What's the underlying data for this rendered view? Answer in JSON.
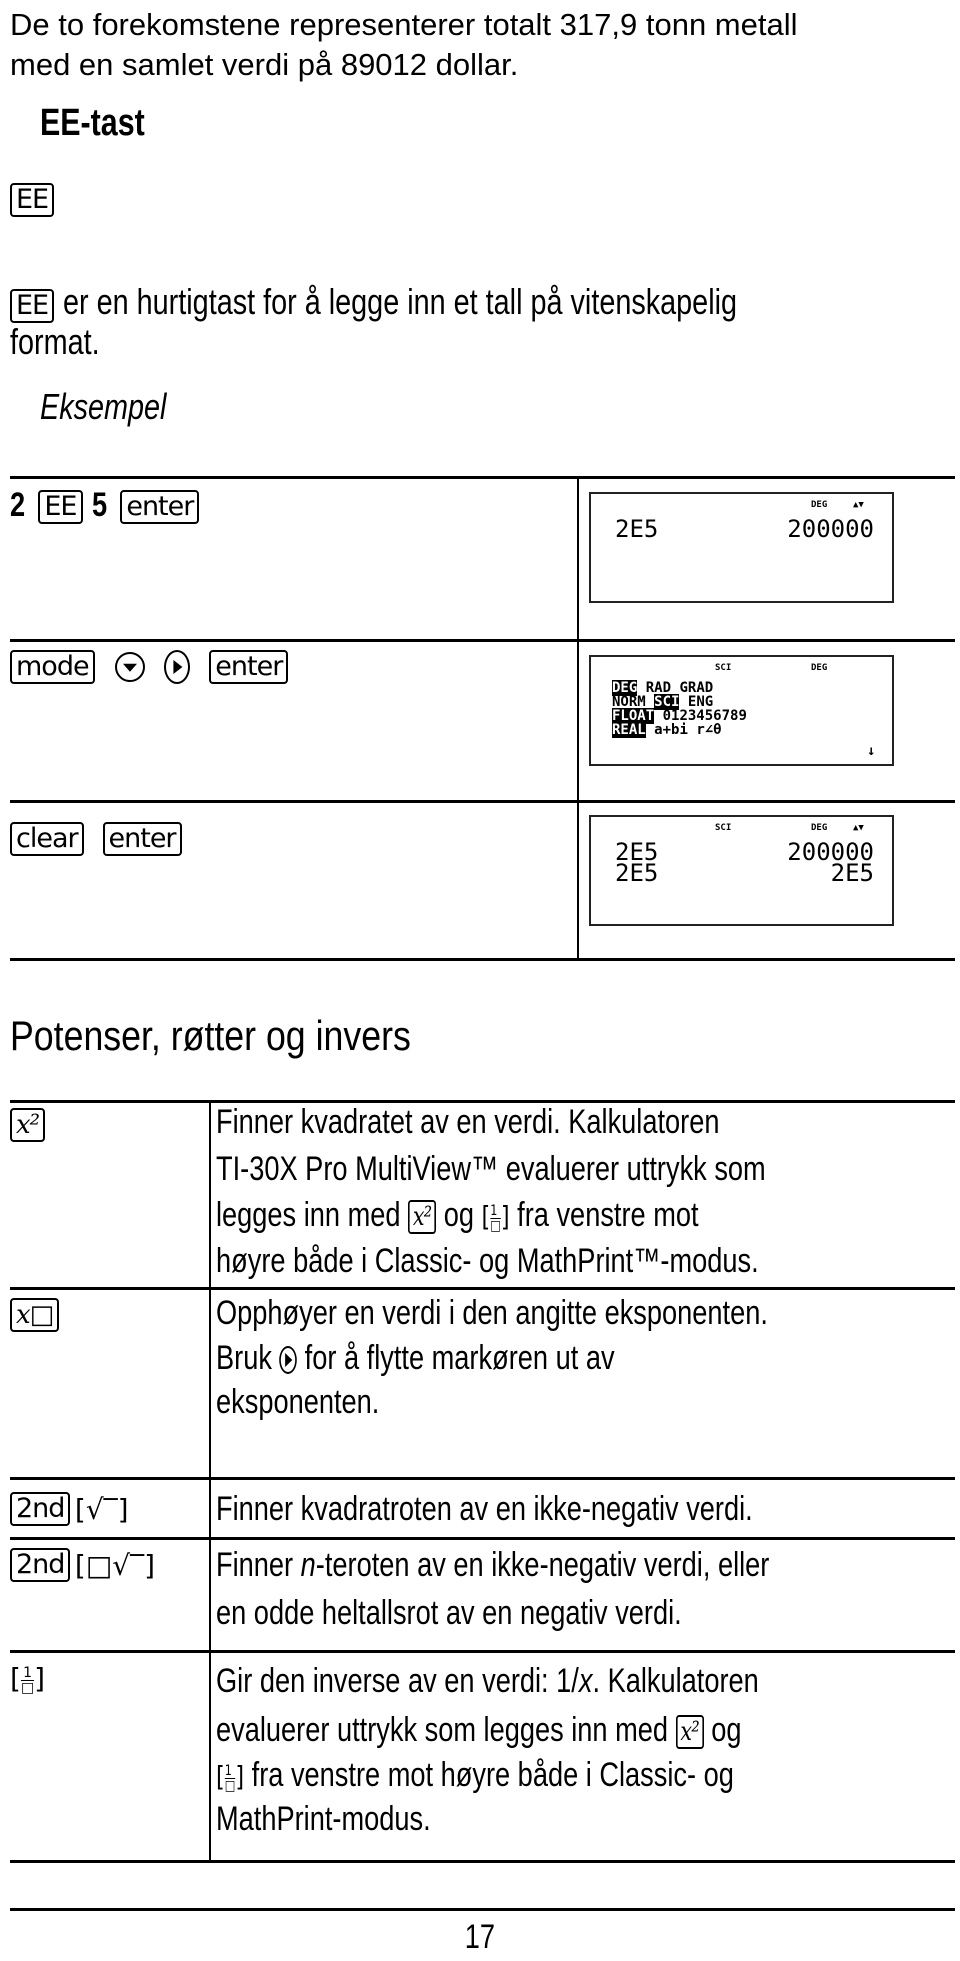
{
  "intro": {
    "lines": [
      "De to forekomstene representerer totalt 317,9 tonn metall",
      "med en samlet verdi på 89012 dollar."
    ]
  },
  "ee": {
    "title": "EE-tast",
    "key": "EE",
    "desc_text": "er en hurtigtast for å legge inn et tall på vitenskapelig",
    "desc_line2": "format.",
    "example_label": "Eksempel"
  },
  "example": {
    "rows": [
      {
        "keys": [
          "2",
          "EE",
          "5",
          "enter"
        ],
        "screen": {
          "indicators": [
            "DEG",
            "▲▼"
          ],
          "lines": [
            {
              "entry": "2E5",
              "result": "200000"
            }
          ]
        }
      },
      {
        "keys": [
          "mode",
          "down-arrow",
          "right-arrow",
          "enter"
        ],
        "screen": {
          "indicators": [
            "SCI",
            "DEG"
          ],
          "menu": [
            [
              "DEG",
              "RAD",
              "GRAD"
            ],
            [
              "NORM",
              "SCI",
              "ENG"
            ],
            [
              "FLOAT",
              "0123456789"
            ],
            [
              "REAL",
              "a+bi",
              "r∠θ"
            ]
          ],
          "more": "↓"
        }
      },
      {
        "keys": [
          "clear",
          "enter"
        ],
        "screen": {
          "indicators": [
            "SCI",
            "DEG",
            "▲▼"
          ],
          "lines": [
            {
              "entry": "2E5",
              "result": "200000"
            },
            {
              "entry": "2E5",
              "result": "2E5"
            }
          ]
        }
      }
    ]
  },
  "powers": {
    "title": "Potenser, røtter og invers",
    "keys": {
      "x2": "x²",
      "xpow": "x□",
      "second": "2nd",
      "sqrt": "√‾",
      "nroot": "□√‾",
      "recip_num": "1",
      "recip_den": "□"
    },
    "rows": [
      {
        "lines": [
          "Finner kvadratet av en verdi. Kalkulatoren",
          "TI-30X Pro MultiView™ evaluerer uttrykk som",
          "legges inn med",
          "og",
          "fra venstre mot",
          "høyre både i Classic- og MathPrint™-modus."
        ]
      },
      {
        "lines": [
          "Opphøyer en verdi i den angitte eksponenten.",
          "Bruk",
          "for å flytte markøren ut av",
          "eksponenten."
        ]
      },
      {
        "lines": [
          "Finner kvadratroten av en ikke-negativ verdi."
        ]
      },
      {
        "lines": [
          "Finner ",
          "n",
          "-teroten av en ikke-negativ verdi, eller",
          "en odde heltallsrot av en negativ verdi."
        ]
      },
      {
        "lines": [
          "Gir den inverse av en verdi: 1/",
          "x",
          ". Kalkulatoren",
          "evaluerer uttrykk som legges inn med",
          "og",
          "fra venstre mot høyre både i Classic- og",
          "MathPrint-modus."
        ]
      }
    ]
  },
  "footer": {
    "page_number": "17"
  }
}
